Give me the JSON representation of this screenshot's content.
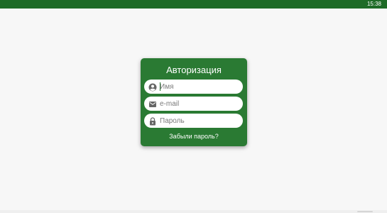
{
  "status_bar": {
    "time": "15:38"
  },
  "login_card": {
    "title": "Авторизация",
    "fields": [
      {
        "name": "name",
        "placeholder": "Имя",
        "icon": "account-circle-icon"
      },
      {
        "name": "email",
        "placeholder": "e-mail",
        "icon": "mail-icon"
      },
      {
        "name": "password",
        "placeholder": "Пароль",
        "icon": "lock-icon"
      }
    ],
    "forgot_link": "Забыли пароль?"
  },
  "colors": {
    "status_bar": "#1e6b27",
    "card_background": "#2a7a33",
    "field_background": "#ffffff",
    "page_background": "#f7f7f7",
    "icon": "#666666"
  }
}
